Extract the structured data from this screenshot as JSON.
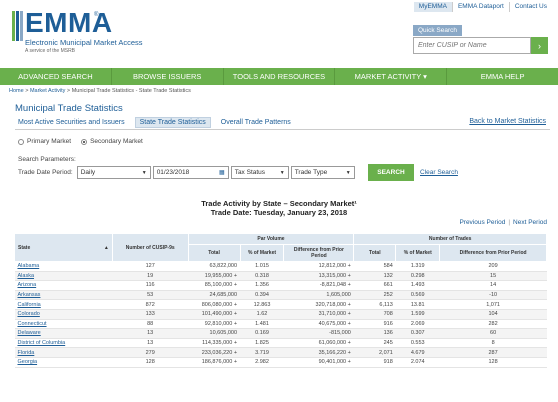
{
  "header": {
    "logo_title": "EMMA",
    "logo_reg": "®",
    "logo_subtitle": "Electronic Municipal Market Access",
    "logo_tagline": "A service of the MSRB",
    "brand_color": "#1e5e97",
    "accent_color": "#6ab04c",
    "utility_links": [
      "MyEMMA",
      "EMMA Dataport",
      "Contact Us"
    ],
    "quick_search_label": "Quick Search",
    "quick_search_placeholder": "Enter CUSIP or Name",
    "quick_search_icon": "chevron-right-icon"
  },
  "nav": {
    "items": [
      "ADVANCED SEARCH",
      "BROWSE ISSUERS",
      "TOOLS AND RESOURCES",
      "MARKET ACTIVITY ▾",
      "EMMA HELP"
    ]
  },
  "breadcrumb": {
    "home": "Home",
    "sep": " > ",
    "market_activity": "Market Activity",
    "current": "Municipal Trade Statistics - State Trade Statistics"
  },
  "page": {
    "title": "Municipal Trade Statistics",
    "tabs": [
      "Most Active Securities and Issuers",
      "State Trade Statistics",
      "Overall Trade Patterns"
    ],
    "active_tab": 1,
    "back_link": "Back to Market Statistics"
  },
  "filters": {
    "market_options": [
      "Primary Market",
      "Secondary Market"
    ],
    "selected_market": "Secondary Market",
    "params_label": "Search Parameters:",
    "trade_date_period_label": "Trade Date Period:",
    "period_value": "Daily",
    "date_value": "01/23/2018",
    "tax_status_value": "Tax Status",
    "trade_type_value": "Trade Type",
    "search_label": "SEARCH",
    "clear_label": "Clear Search"
  },
  "results": {
    "title_line1": "Trade Activity by State – Secondary Market¹",
    "title_line2": "Trade Date: Tuesday, January 23, 2018",
    "prev_label": "Previous Period",
    "pager_sep": "|",
    "next_label": "Next Period"
  },
  "table": {
    "group_headers": {
      "par_volume": "Par Volume",
      "trades": "Number of Trades"
    },
    "columns": {
      "state": "State",
      "cusips": "Number of CUSIP-9s",
      "par_total": "Total",
      "par_pct": "% of Market",
      "par_diff": "Difference from Prior Period",
      "tr_total": "Total",
      "tr_pct": "% of Market",
      "tr_diff": "Difference from Prior Period"
    },
    "rows": [
      {
        "state": "Alabama",
        "cusips": "127",
        "par_total": "63,822,000",
        "par_pct": "1.015",
        "par_diff": "12,812,000 +",
        "tr_total": "584",
        "tr_pct": "1.319",
        "tr_diff": "209"
      },
      {
        "state": "Alaska",
        "cusips": "19",
        "par_total": "19,955,000 +",
        "par_pct": "0.318",
        "par_diff": "13,315,000 +",
        "tr_total": "132",
        "tr_pct": "0.298",
        "tr_diff": "15"
      },
      {
        "state": "Arizona",
        "cusips": "116",
        "par_total": "85,100,000 +",
        "par_pct": "1.356",
        "par_diff": "-8,821,048 +",
        "tr_total": "661",
        "tr_pct": "1.493",
        "tr_diff": "14"
      },
      {
        "state": "Arkansas",
        "cusips": "53",
        "par_total": "24,685,000",
        "par_pct": "0.394",
        "par_diff": "1,605,000",
        "tr_total": "252",
        "tr_pct": "0.569",
        "tr_diff": "-10"
      },
      {
        "state": "California",
        "cusips": "872",
        "par_total": "806,080,000 +",
        "par_pct": "12.863",
        "par_diff": "320,718,000 +",
        "tr_total": "6,113",
        "tr_pct": "13.81",
        "tr_diff": "1,071"
      },
      {
        "state": "Colorado",
        "cusips": "133",
        "par_total": "101,490,000 +",
        "par_pct": "1.62",
        "par_diff": "31,710,000 +",
        "tr_total": "708",
        "tr_pct": "1.599",
        "tr_diff": "104"
      },
      {
        "state": "Connecticut",
        "cusips": "88",
        "par_total": "92,810,000 +",
        "par_pct": "1.481",
        "par_diff": "40,675,000 +",
        "tr_total": "916",
        "tr_pct": "2.069",
        "tr_diff": "282"
      },
      {
        "state": "Delaware",
        "cusips": "13",
        "par_total": "10,605,000",
        "par_pct": "0.169",
        "par_diff": "-815,000",
        "tr_total": "136",
        "tr_pct": "0.307",
        "tr_diff": "60"
      },
      {
        "state": "District of Columbia",
        "cusips": "13",
        "par_total": "114,335,000 +",
        "par_pct": "1.825",
        "par_diff": "61,060,000 +",
        "tr_total": "245",
        "tr_pct": "0.553",
        "tr_diff": "8"
      },
      {
        "state": "Florida",
        "cusips": "279",
        "par_total": "233,036,220 +",
        "par_pct": "3.719",
        "par_diff": "35,166,220 +",
        "tr_total": "2,071",
        "tr_pct": "4.679",
        "tr_diff": "287"
      },
      {
        "state": "Georgia",
        "cusips": "128",
        "par_total": "186,876,000 +",
        "par_pct": "2.982",
        "par_diff": "90,401,000 +",
        "tr_total": "918",
        "tr_pct": "2.074",
        "tr_diff": "128"
      }
    ]
  }
}
